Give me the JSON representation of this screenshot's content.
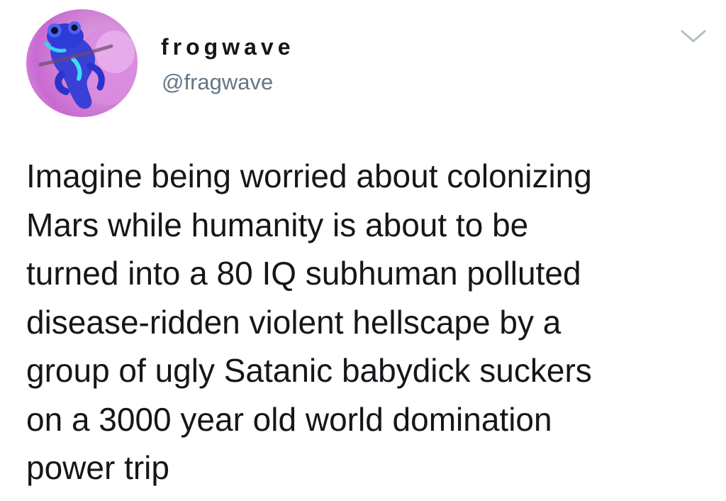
{
  "user": {
    "display_name": "frogwave",
    "handle": "@fragwave",
    "avatar_icon": "blue-frog-avatar"
  },
  "tweet": {
    "text": "Imagine being worried about colonizing\nMars while humanity is about to be\nturned into a 80 IQ subhuman polluted\ndisease-ridden violent hellscape by a\ngroup of ugly Satanic babydick suckers\non a 3000 year old world domination\npower trip"
  },
  "menu": {
    "icon": "chevron-down-icon"
  },
  "colors": {
    "text": "#14171a",
    "handle": "#657786",
    "caret": "#b4bec7"
  }
}
